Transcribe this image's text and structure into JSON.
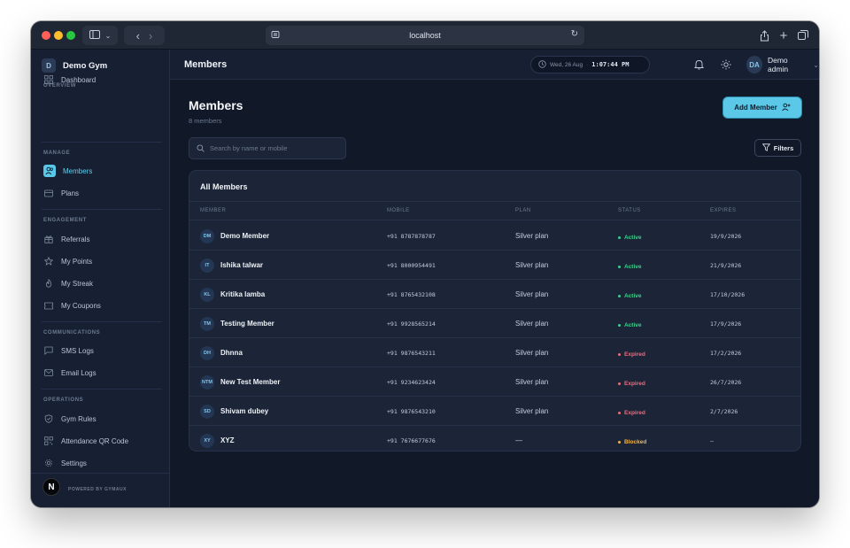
{
  "browser": {
    "url": "localhost"
  },
  "sidebar": {
    "brand_badge": "D",
    "brand_name": "Demo Gym",
    "sections": {
      "overview": "OVERVIEW",
      "manage": "MANAGE",
      "engagement": "ENGAGEMENT",
      "communications": "COMMUNICATIONS",
      "operations": "OPERATIONS"
    },
    "items": {
      "dashboard": "Dashboard",
      "members": "Members",
      "plans": "Plans",
      "referrals": "Referrals",
      "my_points": "My Points",
      "my_streak": "My Streak",
      "my_coupons": "My Coupons",
      "sms_logs": "SMS Logs",
      "email_logs": "Email Logs",
      "gym_rules": "Gym Rules",
      "attendance_qr": "Attendance QR Code",
      "settings": "Settings"
    },
    "footer_logo": "N",
    "powered_by": "POWERED BY GYMAUX"
  },
  "topbar": {
    "title": "Members",
    "date": "Wed, 26 Aug",
    "time": "1:07:44 PM",
    "user_initials": "DA",
    "user_name": "Demo admin"
  },
  "main": {
    "title": "Members",
    "subtitle": "8 members",
    "add_button": "Add Member",
    "search_placeholder": "Search by name or mobile",
    "filters_button": "Filters",
    "card_title": "All Members",
    "columns": {
      "member": "MEMBER",
      "mobile": "MOBILE",
      "plan": "PLAN",
      "status": "STATUS",
      "expires": "EXPIRES"
    },
    "rows": [
      {
        "initials": "DM",
        "name": "Demo Member",
        "mobile": "+91 8787878787",
        "plan": "Silver plan",
        "status": "Active",
        "expires": "19/9/2026"
      },
      {
        "initials": "IT",
        "name": "Ishika talwar",
        "mobile": "+91 8000954491",
        "plan": "Silver plan",
        "status": "Active",
        "expires": "21/9/2026"
      },
      {
        "initials": "KL",
        "name": "Kritika lamba",
        "mobile": "+91 8765432108",
        "plan": "Silver plan",
        "status": "Active",
        "expires": "17/10/2026"
      },
      {
        "initials": "TM",
        "name": "Testing Member",
        "mobile": "+91 9928565214",
        "plan": "Silver plan",
        "status": "Active",
        "expires": "17/9/2026"
      },
      {
        "initials": "DH",
        "name": "Dhnna",
        "mobile": "+91 9876543211",
        "plan": "Silver plan",
        "status": "Expired",
        "expires": "17/2/2026"
      },
      {
        "initials": "NTM",
        "name": "New Test Member",
        "mobile": "+91 9234623424",
        "plan": "Silver plan",
        "status": "Expired",
        "expires": "26/7/2026"
      },
      {
        "initials": "SD",
        "name": "Shivam dubey",
        "mobile": "+91 9876543210",
        "plan": "Silver plan",
        "status": "Expired",
        "expires": "2/7/2026"
      },
      {
        "initials": "XY",
        "name": "XYZ",
        "mobile": "+91 7676677676",
        "plan": "—",
        "status": "Blocked",
        "expires": "–"
      }
    ]
  },
  "colors": {
    "accent": "#5bc8e7",
    "active": "#3ecf8e",
    "expired": "#f06a7a",
    "blocked": "#f0b44c"
  }
}
